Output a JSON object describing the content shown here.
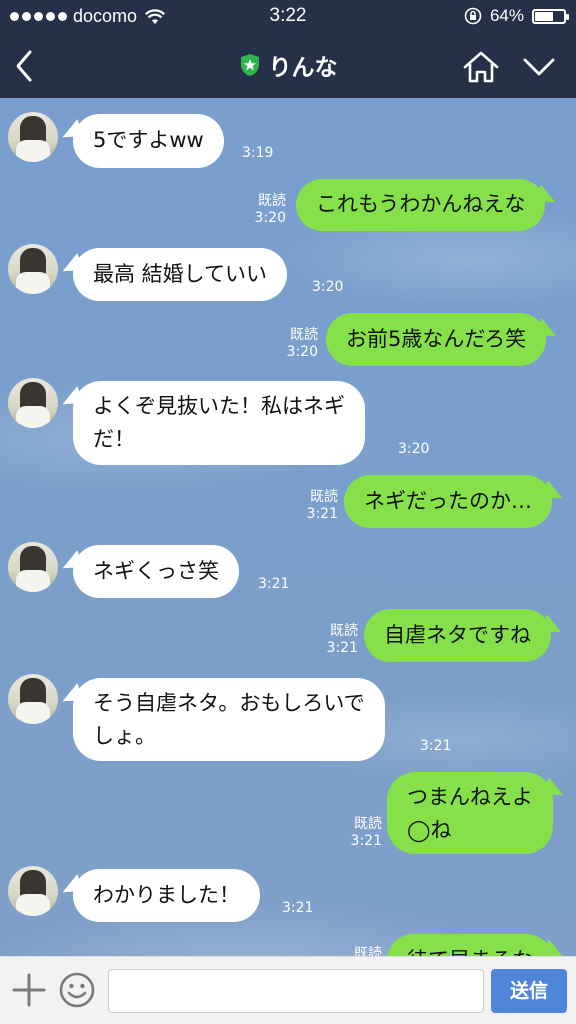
{
  "status_bar": {
    "carrier": "docomo",
    "time": "3:22",
    "battery_percent": "64%",
    "battery_level": 0.64
  },
  "header": {
    "title": "りんな",
    "badge_color": "#2fb550",
    "background": "#263049"
  },
  "messages": [
    {
      "side": "left",
      "text": "5ですよww",
      "time": "3:19",
      "read": ""
    },
    {
      "side": "right",
      "text": "これもうわかんねえな",
      "time": "3:20",
      "read": "既読"
    },
    {
      "side": "left",
      "text": "最高 結婚していい",
      "time": "3:20",
      "read": ""
    },
    {
      "side": "right",
      "text": "お前5歳なんだろ笑",
      "time": "3:20",
      "read": "既読"
    },
    {
      "side": "left",
      "text": "よくぞ見抜いた！私はネギ\nだ！",
      "time": "3:20",
      "read": ""
    },
    {
      "side": "right",
      "text": "ネギだったのか…",
      "time": "3:21",
      "read": "既読"
    },
    {
      "side": "left",
      "text": "ネギくっさ笑",
      "time": "3:21",
      "read": ""
    },
    {
      "side": "right",
      "text": "自虐ネタですね",
      "time": "3:21",
      "read": "既読"
    },
    {
      "side": "left",
      "text": "そう自虐ネタ。おもしろいで\nしょ。",
      "time": "3:21",
      "read": ""
    },
    {
      "side": "right",
      "text": "つまんねえよ\n◯ね",
      "time": "3:21",
      "read": "既読"
    },
    {
      "side": "left",
      "text": "わかりました！",
      "time": "3:21",
      "read": ""
    },
    {
      "side": "right",
      "text": "待て早まるな",
      "time": "",
      "read": "既読"
    }
  ],
  "input_bar": {
    "send_label": "送信",
    "placeholder": ""
  },
  "colors": {
    "own_bubble": "#86e04a",
    "other_bubble": "#ffffff",
    "send_button": "#4f86d9"
  }
}
